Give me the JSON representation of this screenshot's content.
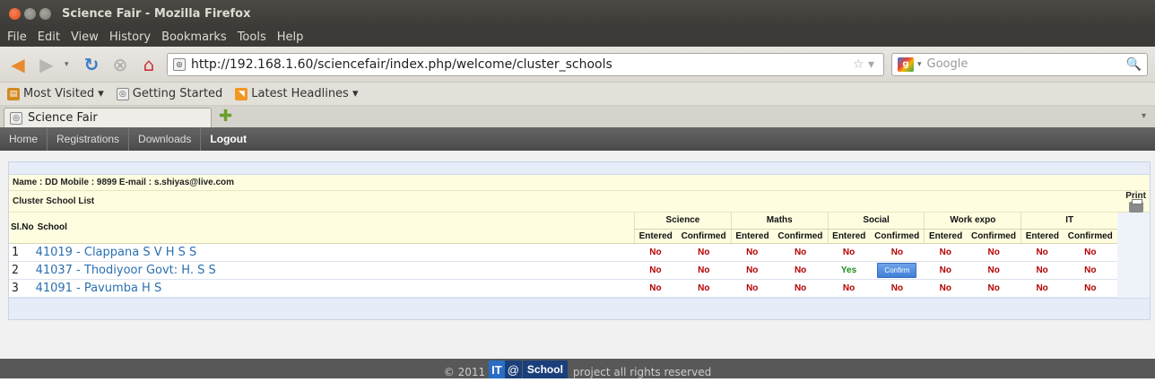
{
  "window": {
    "title": "Science Fair - Mozilla Firefox"
  },
  "menu": [
    "File",
    "Edit",
    "View",
    "History",
    "Bookmarks",
    "Tools",
    "Help"
  ],
  "address": {
    "url": "http://192.168.1.60/sciencefair/index.php/welcome/cluster_schools"
  },
  "search": {
    "placeholder": "Google"
  },
  "bookmarks": [
    "Most Visited ▾",
    "Getting Started",
    "Latest Headlines ▾"
  ],
  "tab": {
    "title": "Science Fair"
  },
  "sitenav": [
    "Home",
    "Registrations",
    "Downloads",
    "Logout"
  ],
  "user": {
    "info": "Name : DD   Mobile : 9899   E-mail : s.shiyas@live.com"
  },
  "list": {
    "title": "Cluster School List",
    "print_label": "Print"
  },
  "table": {
    "sl_header": "Sl.No",
    "school_header": "School",
    "groups": [
      "Science",
      "Maths",
      "Social",
      "Work expo",
      "IT"
    ],
    "sub_entered": "Entered",
    "sub_confirmed": "Confirmed",
    "rows": [
      {
        "sl": "1",
        "school": "41019 - Clappana S V H S S",
        "science_e": "No",
        "science_c": "No",
        "maths_e": "No",
        "maths_c": "No",
        "social_e": "No",
        "social_c": "No",
        "work_e": "No",
        "work_c": "No",
        "it_e": "No",
        "it_c": "No"
      },
      {
        "sl": "2",
        "school": "41037 - Thodiyoor Govt: H. S S",
        "science_e": "No",
        "science_c": "No",
        "maths_e": "No",
        "maths_c": "No",
        "social_e": "Yes",
        "social_c": "Confirm",
        "work_e": "No",
        "work_c": "No",
        "it_e": "No",
        "it_c": "No"
      },
      {
        "sl": "3",
        "school": "41091 - Pavumba H S",
        "science_e": "No",
        "science_c": "No",
        "maths_e": "No",
        "maths_c": "No",
        "social_e": "No",
        "social_c": "No",
        "work_e": "No",
        "work_c": "No",
        "it_e": "No",
        "it_c": "No"
      }
    ]
  },
  "footer": {
    "copy": "© 2011",
    "logo_it": "IT",
    "logo_at": "@",
    "logo_school": "School",
    "rights": "project all rights reserved"
  }
}
